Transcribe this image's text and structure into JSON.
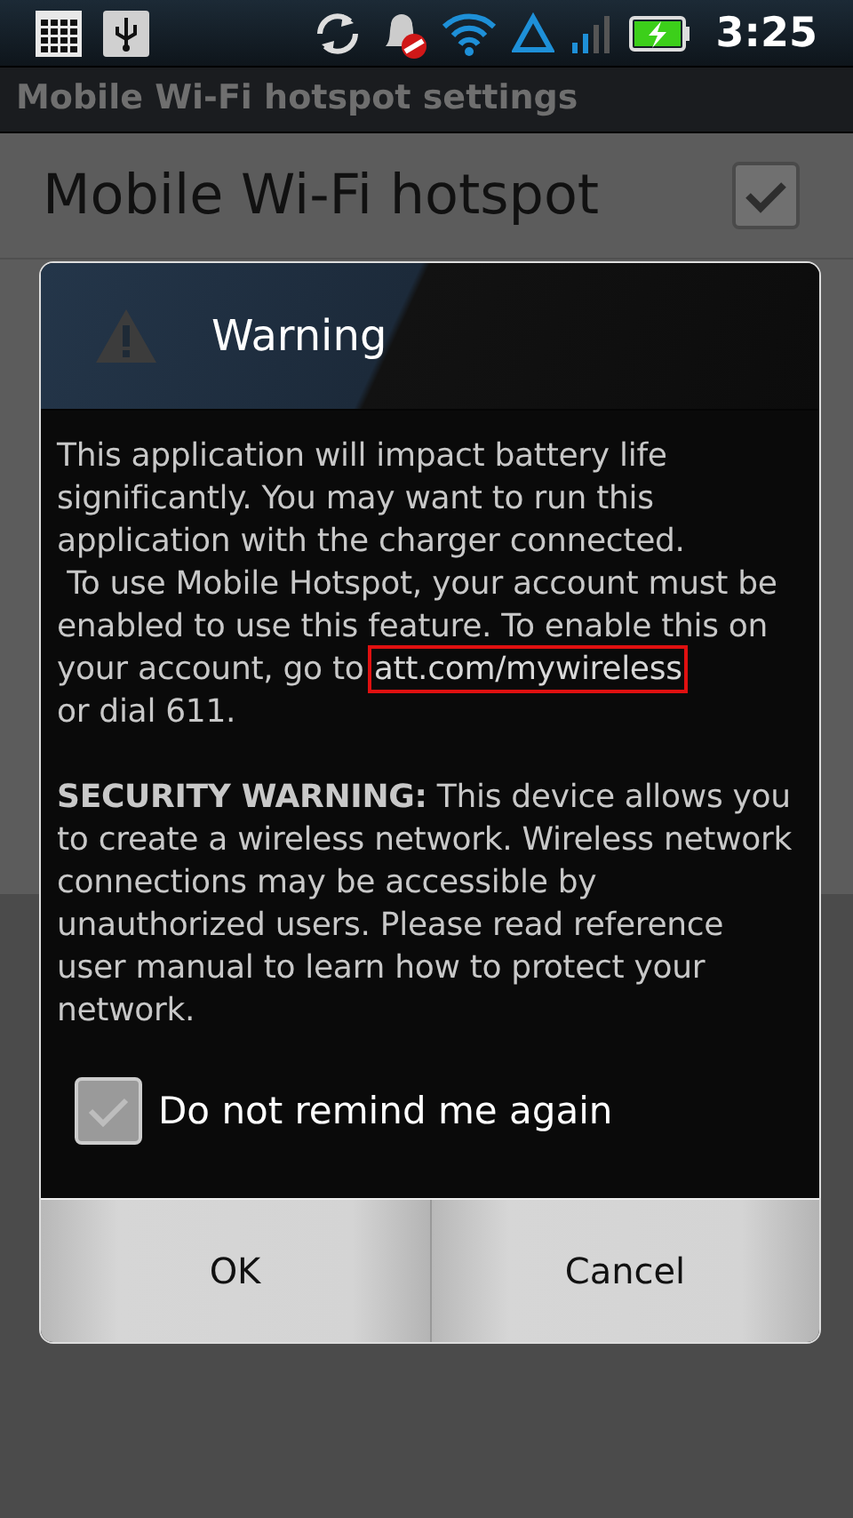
{
  "status_bar": {
    "time": "3:25"
  },
  "title_bar": {
    "title": "Mobile Wi-Fi hotspot settings"
  },
  "settings": [
    {
      "label": "Mobile Wi-Fi hotspot",
      "checked": true
    }
  ],
  "dialog": {
    "title": "Warning",
    "paragraphs": [
      {
        "text": "This application will impact battery life significantly. You may want to run this application with the charger connected.\n To use Mobile Hotspot, your account must be enabled to use this feature. To enable this on your account, go to ",
        "link": "att.com/mywireless",
        "after": "\nor dial 611."
      },
      {
        "text": "**SECURITY WARNING:** This device allows you to create a wireless network. Wireless network connections may be accessible by unauthorized users. Please read reference user manual to learn how to protect your network."
      }
    ],
    "checkbox": {
      "label": "Do not remind me again",
      "checked": true
    },
    "buttons": [
      {
        "label": "OK"
      },
      {
        "label": "Cancel"
      }
    ]
  }
}
